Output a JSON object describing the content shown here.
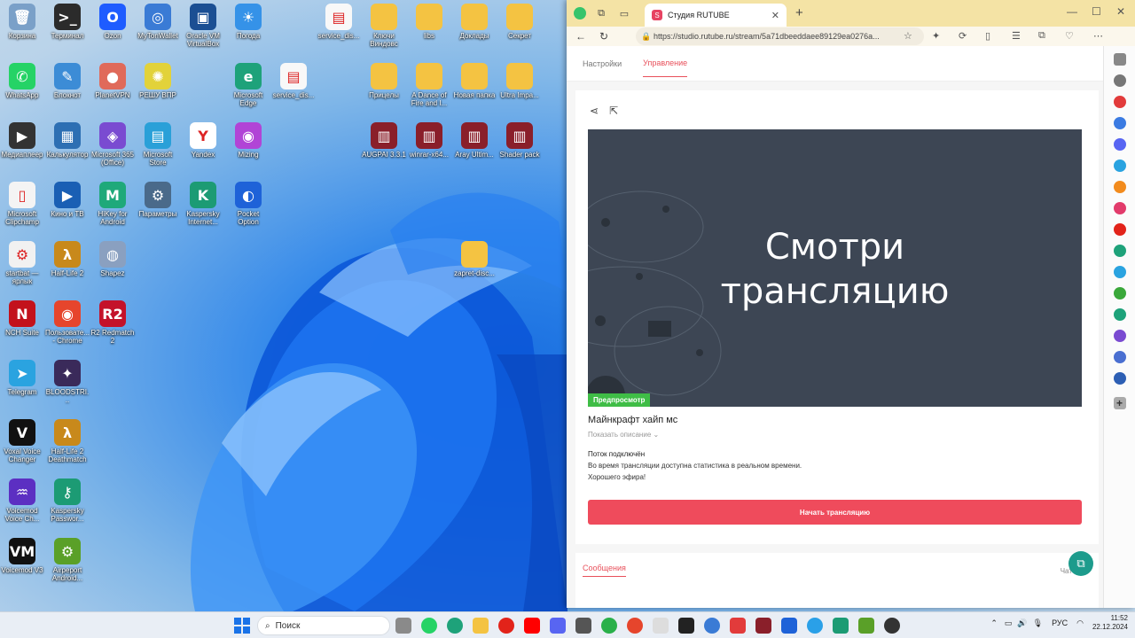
{
  "desktop": {
    "icons": [
      {
        "label": "Корзина",
        "color": "#7aa0c8",
        "glyph": "🗑"
      },
      {
        "label": "Терминал",
        "color": "#2b2b2b",
        "glyph": ">_"
      },
      {
        "label": "Ozon",
        "color": "#1e5cff",
        "glyph": "O"
      },
      {
        "label": "MyTonWallet",
        "color": "#3a7bd5",
        "glyph": "◎"
      },
      {
        "label": "Oracle VM VirtualBox",
        "color": "#1b4f93",
        "glyph": "▣"
      },
      {
        "label": "Погода",
        "color": "#3592e8",
        "glyph": "☀"
      },
      {
        "label": "WhatsApp",
        "color": "#25d366",
        "glyph": "✆"
      },
      {
        "label": "Блокнот",
        "color": "#3c8cd6",
        "glyph": "✎"
      },
      {
        "label": "PlanetVPN",
        "color": "#e06a5a",
        "glyph": "●"
      },
      {
        "label": "РЕШУ ВПР",
        "color": "#e2d23a",
        "glyph": "✺"
      },
      {
        "label": "Медиаплеер",
        "color": "#333",
        "glyph": "▶"
      },
      {
        "label": "Калькулятор",
        "color": "#2d6fb3",
        "glyph": "▦"
      },
      {
        "label": "Microsoft 365 (Office)",
        "color": "#7a4bd1",
        "glyph": "◈"
      },
      {
        "label": "Microsoft Store",
        "color": "#2aa0d8",
        "glyph": "▤"
      },
      {
        "label": "Yandex",
        "color": "#ffffff",
        "glyph": "Y"
      },
      {
        "label": "Mizing",
        "color": "#b144d6",
        "glyph": "◉"
      },
      {
        "label": "Microsoft Clipchamp",
        "color": "#f4f4f4",
        "glyph": "▯"
      },
      {
        "label": "Кино и ТВ",
        "color": "#1a5fb4",
        "glyph": "▶"
      },
      {
        "label": "HiKey for Android",
        "color": "#1fa97a",
        "glyph": "M"
      },
      {
        "label": "Параметры",
        "color": "#4a6a8a",
        "glyph": "⚙"
      },
      {
        "label": "Kaspersky Internet...",
        "color": "#1c9b74",
        "glyph": "K"
      },
      {
        "label": "Pocket Option",
        "color": "#1e62d8",
        "glyph": "◐"
      },
      {
        "label": "startbat — ярлык",
        "color": "#f1f1f1",
        "glyph": "⚙"
      },
      {
        "label": "Half-Life 2",
        "color": "#c8891b",
        "glyph": "λ"
      },
      {
        "label": "Shapez",
        "color": "#8aa0c0",
        "glyph": "◍"
      },
      {
        "label": "NCH Suite",
        "color": "#c3121c",
        "glyph": "N"
      },
      {
        "label": "Пользовате... - Chrome",
        "color": "#e6452c",
        "glyph": "◉"
      },
      {
        "label": "R2 Redmatch 2",
        "color": "#c4122a",
        "glyph": "R2"
      },
      {
        "label": "Telegram",
        "color": "#2aa3e0",
        "glyph": "➤"
      },
      {
        "label": "BLOODSTRI...",
        "color": "#3a2a5a",
        "glyph": "✦"
      },
      {
        "label": "Voxal Voice Changer",
        "color": "#111",
        "glyph": "V"
      },
      {
        "label": "Half-Life 2 Deathmatch",
        "color": "#c8891b",
        "glyph": "λ"
      },
      {
        "label": "Voicemod Voice Ch...",
        "color": "#5c2fc2",
        "glyph": "♒"
      },
      {
        "label": "Kaspersky Passwor...",
        "color": "#1c9b74",
        "glyph": "⚷"
      },
      {
        "label": "Voicemod V3",
        "color": "#111",
        "glyph": "VM"
      },
      {
        "label": "Airpeport Android...",
        "color": "#5aa028",
        "glyph": "⚙"
      },
      {
        "label": "service_dis...",
        "color": "#f8f8f8",
        "glyph": "▤"
      },
      {
        "label": "Ключи Виндовс",
        "color": "#f4c342",
        "glyph": ""
      },
      {
        "label": "libs",
        "color": "#f4c342",
        "glyph": ""
      },
      {
        "label": "Доклады",
        "color": "#f4c342",
        "glyph": ""
      },
      {
        "label": "Секрет",
        "color": "#f4c342",
        "glyph": ""
      },
      {
        "label": "Microsoft Edge",
        "color": "#1ea27a",
        "glyph": "e"
      },
      {
        "label": "service_dis...",
        "color": "#f8f8f8",
        "glyph": "▤"
      },
      {
        "label": "Прицелы",
        "color": "#f4c342",
        "glyph": ""
      },
      {
        "label": "A Dance of Fire and I...",
        "color": "#f4c342",
        "glyph": ""
      },
      {
        "label": "Новая папка",
        "color": "#f4c342",
        "glyph": ""
      },
      {
        "label": "Ultra Impa...",
        "color": "#f4c342",
        "glyph": ""
      },
      {
        "label": "AUGPAI 3.3.1",
        "color": "#8a1f2a",
        "glyph": "▥"
      },
      {
        "label": "winrar-x64...",
        "color": "#8a1f2a",
        "glyph": "▥"
      },
      {
        "label": "Aray Ultim...",
        "color": "#8a1f2a",
        "glyph": "▥"
      },
      {
        "label": "Shader pack",
        "color": "#8a1f2a",
        "glyph": "▥"
      },
      {
        "label": "zapret-disc...",
        "color": "#f4c342",
        "glyph": ""
      }
    ]
  },
  "browser": {
    "tab_title": "Студия RUTUBE",
    "url": "https://studio.rutube.ru/stream/5a71dbeeddaee89129ea0276a...",
    "page": {
      "tabs": [
        "Настройки",
        "Управление"
      ],
      "preview_text_line1": "Смотри",
      "preview_text_line2": "трансляцию",
      "preview_badge": "Предпросмотр",
      "stream_title": "Майнкрафт хайп мс",
      "show_description": "Показать описание",
      "status_title": "Поток подключён",
      "status_line1": "Во время трансляции доступна статистика в реальном времени.",
      "status_line2": "Хорошего эфира!",
      "start_button": "Начать трансляцию",
      "messages_tab": "Сообщения",
      "chat_label": "Чат"
    }
  },
  "taskbar": {
    "search_placeholder": "Поиск",
    "lang": "РУС",
    "time": "11:52",
    "date": "22.12.2024"
  }
}
